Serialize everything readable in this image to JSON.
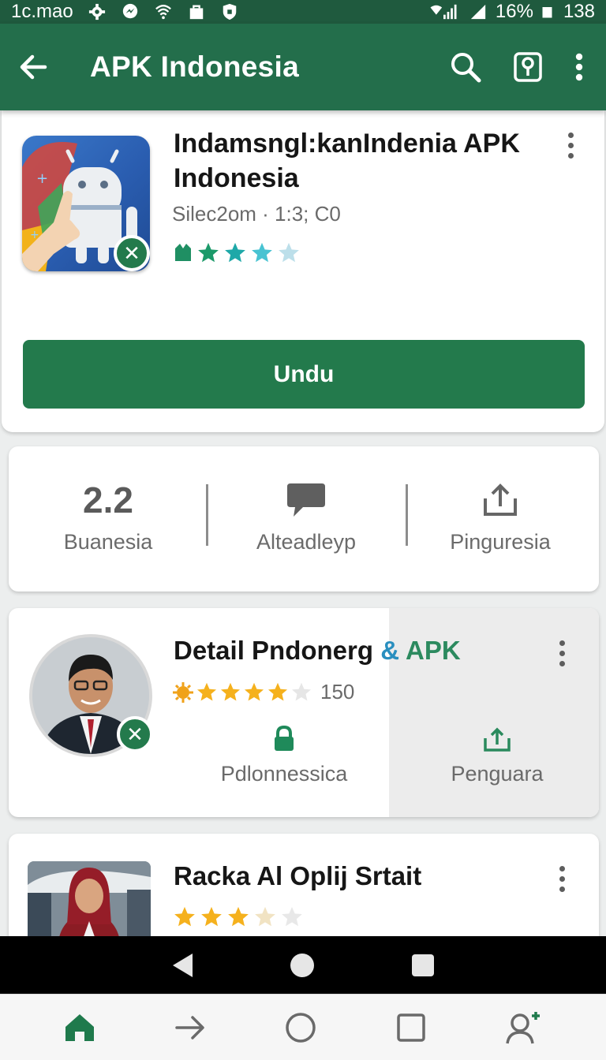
{
  "status_bar": {
    "left_text": "1c.mao",
    "battery": "16%",
    "right_number": "138",
    "icons": [
      "settings-icon",
      "messenger-icon",
      "wifi-icon",
      "bag-icon",
      "shield-icon",
      "signal-icon",
      "battery-icon"
    ]
  },
  "app_bar": {
    "title": "APK Indonesia",
    "icons": [
      "back-arrow-icon",
      "search-icon",
      "location-pin-icon",
      "more-vert-icon"
    ],
    "color": "#236e4b"
  },
  "app_card": {
    "title": "Indamsngl:kanIndenia APK Indonesia",
    "meta": "Silec2om · 1:3; C0",
    "rating_stars": 3.5,
    "button_label": "Undu",
    "button_color": "#237a4c"
  },
  "stats": [
    {
      "value": "2.2",
      "label": "Buanesia"
    },
    {
      "icon": "chat-bubble-icon",
      "label": "Alteadleyp"
    },
    {
      "icon": "share-upload-icon",
      "label": "Pinguresia"
    }
  ],
  "review_card": {
    "title_main": "Detail Pndonerg",
    "title_amp": "&",
    "title_accent": "APK",
    "rating_stars": 4,
    "rating_count": "150",
    "action_left_label": "Pdlonnessica",
    "action_right_label": "Penguara"
  },
  "second_card": {
    "title": "Racka Al Oplij Srtait",
    "rating_stars": 3
  },
  "bottom_tabs": [
    "home-icon",
    "arrow-right-icon",
    "circle-icon",
    "square-icon",
    "profile-icon"
  ]
}
